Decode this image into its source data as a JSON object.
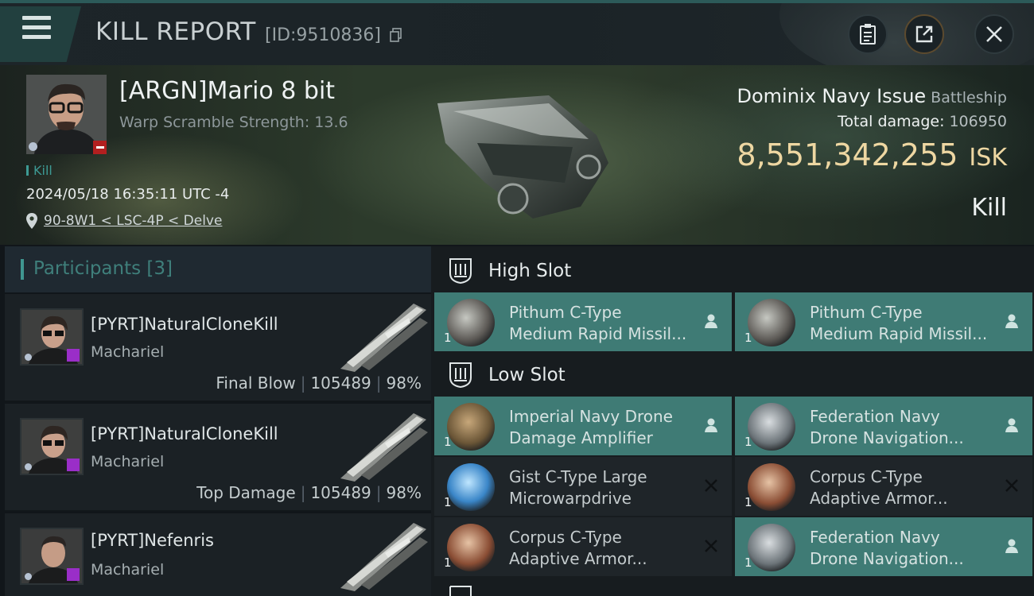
{
  "header": {
    "title": "KILL REPORT",
    "report_id": "[ID:9510836]",
    "buttons": [
      "clipboard-icon",
      "share-icon",
      "close-icon"
    ]
  },
  "victim": {
    "pilot_name": "[ARGN]Mario 8 bit",
    "warp_scramble": "Warp Scramble Strength: 13.6",
    "kill_tag": "Kill",
    "datetime": "2024/05/18 16:35:11 UTC -4",
    "location": "90-8W1 < LSC-4P < Delve",
    "ship_name": "Dominix Navy Issue",
    "ship_class": "Battleship",
    "total_damage_label": "Total damage:",
    "total_damage": "106950",
    "isk_value": "8,551,342,255",
    "isk_unit": "ISK",
    "result": "Kill"
  },
  "participants": {
    "label": "Participants",
    "count": "[3]",
    "items": [
      {
        "name": "[PYRT]NaturalCloneKill",
        "ship": "Machariel",
        "role": "Final Blow",
        "damage": "105489",
        "percent": "98%"
      },
      {
        "name": "[PYRT]NaturalCloneKill",
        "ship": "Machariel",
        "role": "Top Damage",
        "damage": "105489",
        "percent": "98%"
      },
      {
        "name": "[PYRT]Nefenris",
        "ship": "Machariel",
        "role": "",
        "damage": "",
        "percent": ""
      }
    ]
  },
  "fitting": {
    "high_slot": {
      "label": "High Slot",
      "modules": [
        {
          "qty": "1",
          "line1": "Pithum C-Type",
          "line2": "Medium Rapid Missil...",
          "state": "fitted",
          "icon": "launcher-icon"
        },
        {
          "qty": "1",
          "line1": "Pithum C-Type",
          "line2": "Medium Rapid Missil...",
          "state": "fitted",
          "icon": "launcher-icon"
        }
      ]
    },
    "low_slot": {
      "label": "Low Slot",
      "modules": [
        {
          "qty": "1",
          "line1": "Imperial Navy Drone",
          "line2": "Damage Amplifier",
          "state": "fitted",
          "icon": "drone-amplifier-icon"
        },
        {
          "qty": "1",
          "line1": "Federation Navy",
          "line2": "Drone Navigation...",
          "state": "fitted",
          "icon": "drone-navigation-icon"
        },
        {
          "qty": "1",
          "line1": "Gist C-Type Large",
          "line2": "Microwarpdrive",
          "state": "destroyed",
          "icon": "microwarpdrive-icon"
        },
        {
          "qty": "1",
          "line1": "Corpus C-Type",
          "line2": "Adaptive Armor...",
          "state": "destroyed",
          "icon": "armor-hardener-icon"
        },
        {
          "qty": "1",
          "line1": "Corpus C-Type",
          "line2": "Adaptive Armor...",
          "state": "destroyed",
          "icon": "armor-hardener-icon"
        },
        {
          "qty": "1",
          "line1": "Federation Navy",
          "line2": "Drone Navigation...",
          "state": "fitted",
          "icon": "drone-navigation-icon"
        }
      ]
    }
  },
  "colors": {
    "accent_teal": "#3f7b75",
    "isk_gold": "#eed7a2",
    "panel_dark": "#1b2125"
  }
}
